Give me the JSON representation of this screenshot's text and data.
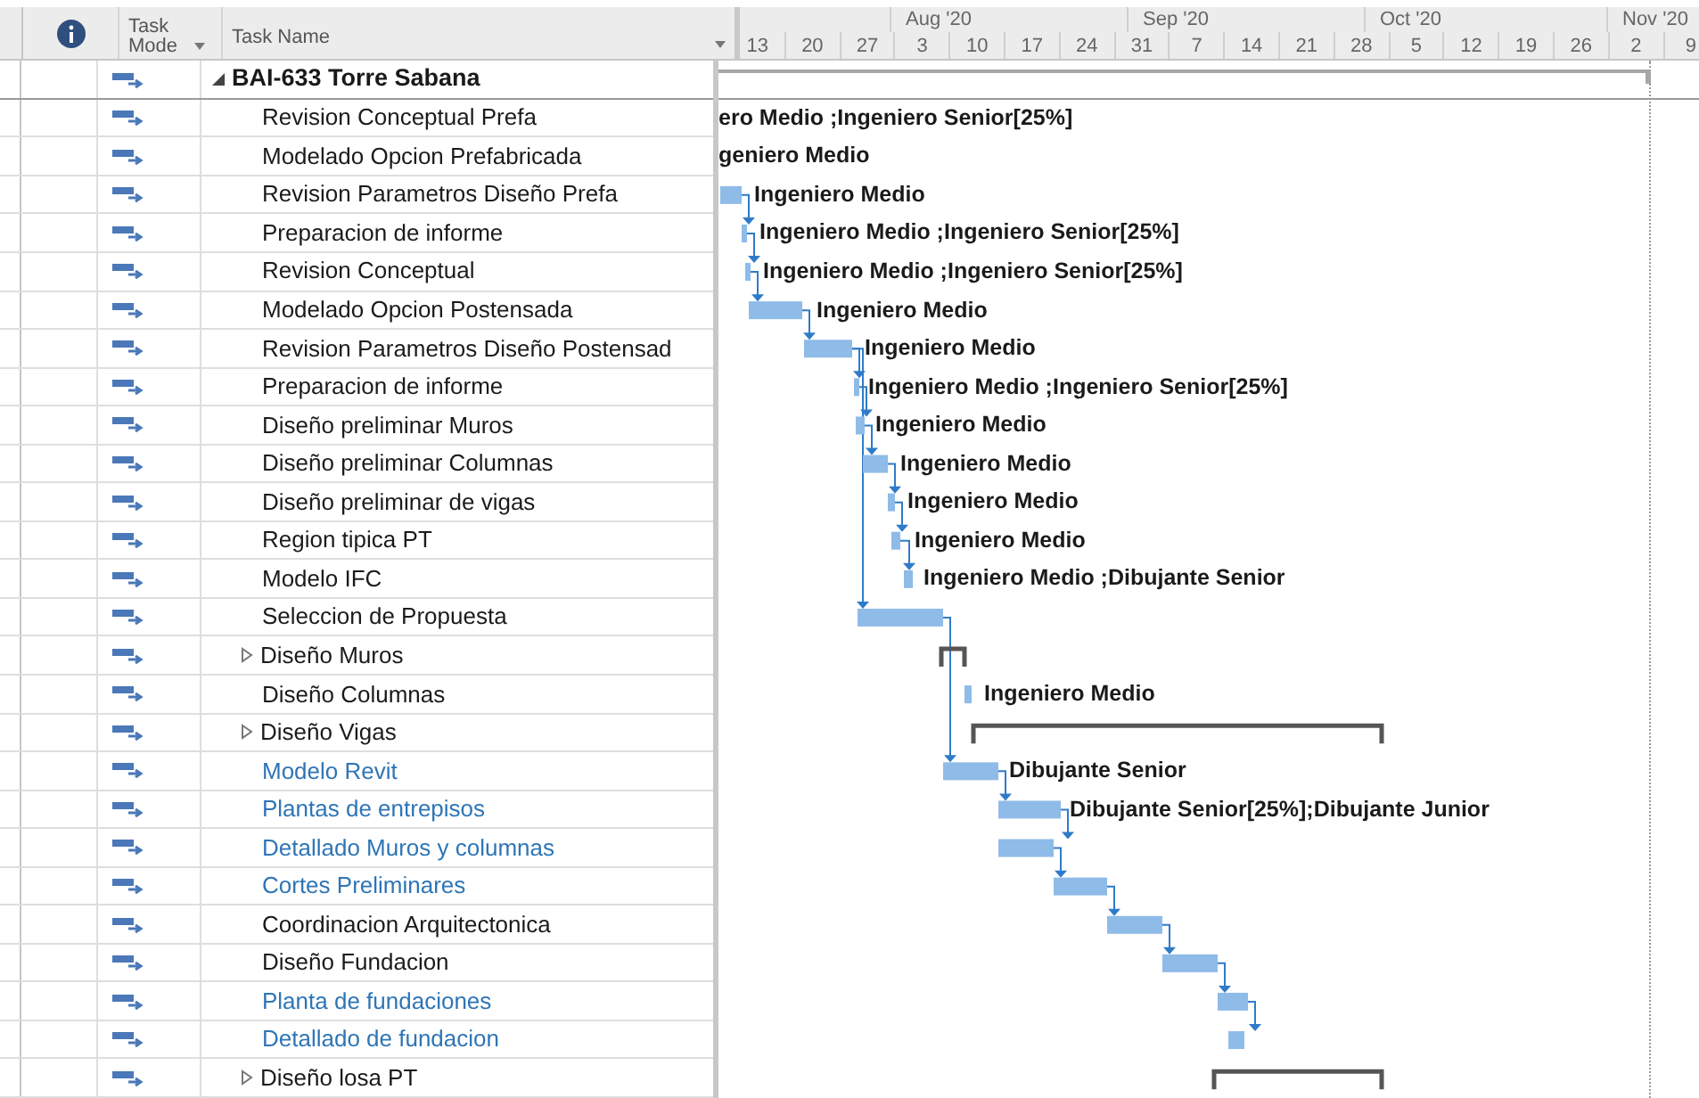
{
  "columns": {
    "task_mode": "Task Mode",
    "task_name": "Task Name"
  },
  "timeline": {
    "months": [
      "Aug '20",
      "Sep '20",
      "Oct '20",
      "Nov '20"
    ],
    "weeks": [
      "13",
      "20",
      "27",
      "3",
      "10",
      "17",
      "24",
      "31",
      "7",
      "14",
      "21",
      "28",
      "5",
      "12",
      "19",
      "26",
      "2",
      "9"
    ]
  },
  "project": {
    "name": "BAI-633 Torre Sabana",
    "expanded": true,
    "children": [
      {
        "kind": "task",
        "name": "Revision Conceptual Prefa",
        "color": "#1a1a1a",
        "resources": "ero Medio ;Ingeniero Senior[25%]"
      },
      {
        "kind": "task",
        "name": "Modelado Opcion Prefabricada",
        "color": "#1a1a1a",
        "resources": "geniero Medio"
      },
      {
        "kind": "task",
        "name": "Revision Parametros Diseño Prefa",
        "color": "#1a1a1a",
        "resources": "Ingeniero Medio"
      },
      {
        "kind": "task",
        "name": "Preparacion de informe",
        "color": "#1a1a1a",
        "resources": "Ingeniero Medio ;Ingeniero Senior[25%]"
      },
      {
        "kind": "task",
        "name": "Revision Conceptual",
        "color": "#1a1a1a",
        "resources": "Ingeniero Medio ;Ingeniero Senior[25%]"
      },
      {
        "kind": "task",
        "name": "Modelado Opcion Postensada",
        "color": "#1a1a1a",
        "resources": "Ingeniero Medio"
      },
      {
        "kind": "task",
        "name": "Revision Parametros Diseño Postensad",
        "color": "#1a1a1a",
        "resources": "Ingeniero Medio"
      },
      {
        "kind": "task",
        "name": "Preparacion de informe",
        "color": "#1a1a1a",
        "resources": "Ingeniero Medio ;Ingeniero Senior[25%]"
      },
      {
        "kind": "task",
        "name": "Diseño preliminar Muros",
        "color": "#1a1a1a",
        "resources": "Ingeniero Medio"
      },
      {
        "kind": "task",
        "name": "Diseño preliminar Columnas",
        "color": "#1a1a1a",
        "resources": "Ingeniero Medio"
      },
      {
        "kind": "task",
        "name": "Diseño preliminar de vigas",
        "color": "#1a1a1a",
        "resources": "Ingeniero Medio"
      },
      {
        "kind": "task",
        "name": "Region tipica PT",
        "color": "#1a1a1a",
        "resources": "Ingeniero Medio"
      },
      {
        "kind": "task",
        "name": "Modelo IFC",
        "color": "#1a1a1a",
        "resources": "Ingeniero Medio ;Dibujante Senior"
      },
      {
        "kind": "task",
        "name": "Seleccion de Propuesta",
        "color": "#1a1a1a"
      },
      {
        "kind": "summary",
        "name": "Diseño Muros",
        "color": "#1a1a1a",
        "expanded": false
      },
      {
        "kind": "task",
        "name": "Diseño Columnas",
        "color": "#1a1a1a",
        "resources": "Ingeniero Medio"
      },
      {
        "kind": "summary",
        "name": "Diseño Vigas",
        "color": "#1a1a1a",
        "expanded": false
      },
      {
        "kind": "task",
        "name": "Modelo Revit",
        "color": "#2e75b6",
        "resources": "Dibujante Senior"
      },
      {
        "kind": "task",
        "name": "Plantas de entrepisos",
        "color": "#2e75b6",
        "resources": "Dibujante Senior[25%];Dibujante Junior"
      },
      {
        "kind": "task",
        "name": "Detallado Muros y columnas",
        "color": "#2e75b6"
      },
      {
        "kind": "task",
        "name": "Cortes Preliminares",
        "color": "#2e75b6"
      },
      {
        "kind": "task",
        "name": "Coordinacion Arquitectonica",
        "color": "#1a1a1a"
      },
      {
        "kind": "task",
        "name": "Diseño Fundacion",
        "color": "#1a1a1a"
      },
      {
        "kind": "task",
        "name": "Planta de fundaciones",
        "color": "#2e75b6"
      },
      {
        "kind": "task",
        "name": "Detallado de fundacion",
        "color": "#2e75b6"
      },
      {
        "kind": "summary",
        "name": "Diseño losa PT",
        "color": "#1a1a1a",
        "expanded": false
      }
    ]
  }
}
